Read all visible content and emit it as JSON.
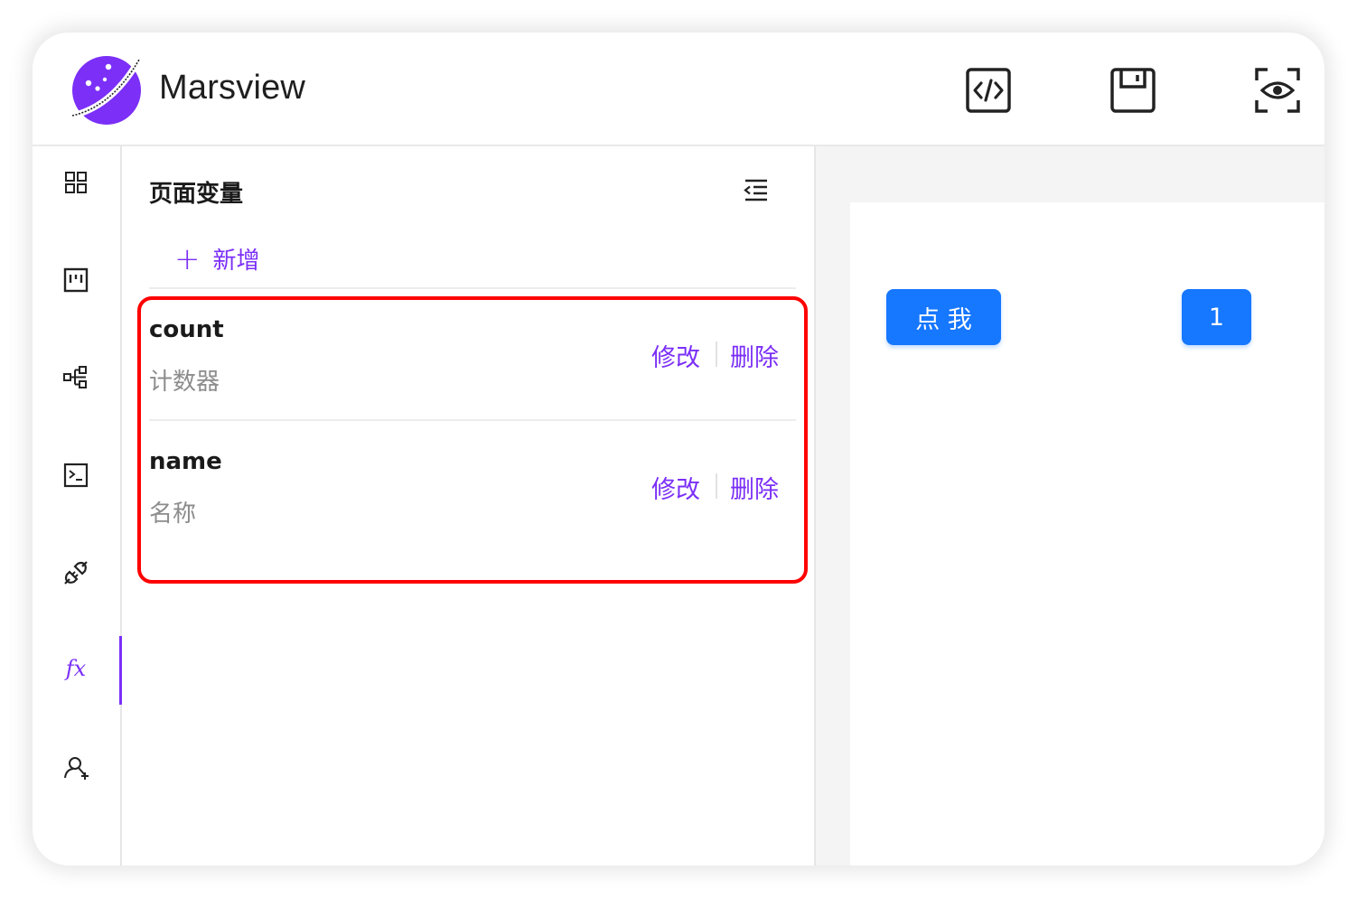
{
  "app": {
    "title": "Marsview",
    "accent": "#7b2ff7",
    "primary": "#1677ff"
  },
  "header": {
    "actions": [
      {
        "name": "code-icon"
      },
      {
        "name": "save-icon"
      },
      {
        "name": "preview-icon"
      }
    ]
  },
  "rail": {
    "items": [
      {
        "icon": "grid-icon"
      },
      {
        "icon": "board-icon"
      },
      {
        "icon": "tree-icon"
      },
      {
        "icon": "terminal-icon"
      },
      {
        "icon": "plug-icon"
      },
      {
        "icon": "fx-icon",
        "label": "fx",
        "active": true
      },
      {
        "icon": "user-add-icon"
      }
    ]
  },
  "panel": {
    "title": "页面变量",
    "add_label": "新增",
    "variables": [
      {
        "name": "count",
        "desc": "计数器",
        "edit": "修改",
        "delete": "删除"
      },
      {
        "name": "name",
        "desc": "名称",
        "edit": "修改",
        "delete": "删除"
      }
    ]
  },
  "canvas": {
    "click_button": "点 我",
    "value_button": "1"
  }
}
